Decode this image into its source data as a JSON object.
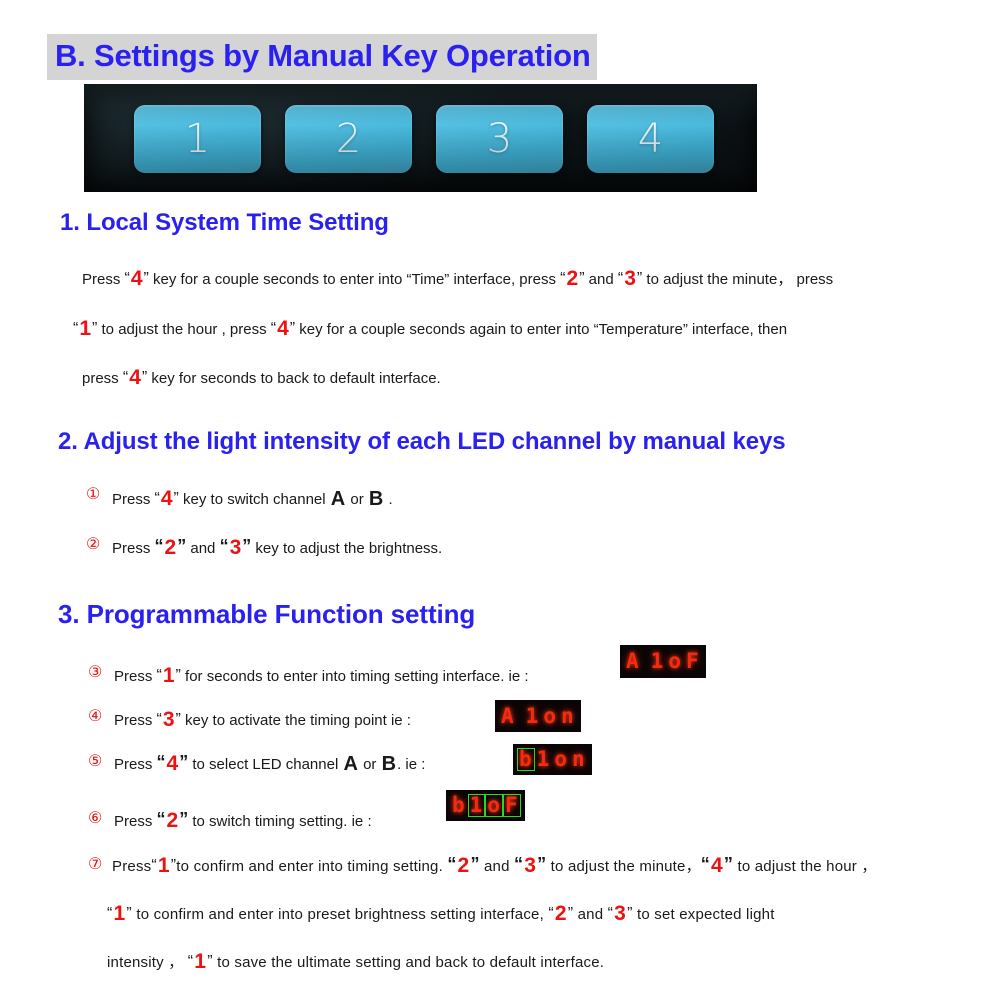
{
  "document": {
    "section_title": "B. Settings by Manual Key Operation",
    "title_highlight_color": "#d4d4d4",
    "heading_color": "#2a21f0",
    "key_accent_color": "#ee1111"
  },
  "keypad_photo": {
    "alt": "photo of four blue membrane keys",
    "keys": [
      "1",
      "2",
      "3",
      "4"
    ],
    "key_color": "#4ebcdf",
    "background_color": "#0c1215"
  },
  "sections": [
    {
      "id": "sec1",
      "heading": "1. Local System Time Setting",
      "lines": [
        {
          "id": "s1l1",
          "parts": [
            {
              "t": "text",
              "v": "Press "
            },
            {
              "t": "quote",
              "v": "“"
            },
            {
              "t": "key",
              "v": "4"
            },
            {
              "t": "quote",
              "v": "”"
            },
            {
              "t": "text",
              "v": " key for a couple seconds to enter into “Time” interface, press "
            },
            {
              "t": "quote",
              "v": "“"
            },
            {
              "t": "key",
              "v": "2"
            },
            {
              "t": "quote",
              "v": "”"
            },
            {
              "t": "text",
              "v": " and "
            },
            {
              "t": "quote",
              "v": "“"
            },
            {
              "t": "key",
              "v": "3"
            },
            {
              "t": "quote",
              "v": "”"
            },
            {
              "t": "text",
              "v": " to adjust the minute， press"
            }
          ]
        },
        {
          "id": "s1l2",
          "parts": [
            {
              "t": "quote",
              "v": "“"
            },
            {
              "t": "key",
              "v": "1"
            },
            {
              "t": "quote",
              "v": "”"
            },
            {
              "t": "text",
              "v": " to adjust the hour , press "
            },
            {
              "t": "quote",
              "v": "“"
            },
            {
              "t": "key",
              "v": "4"
            },
            {
              "t": "quote",
              "v": "”"
            },
            {
              "t": "text",
              "v": " key for a couple seconds again to enter into “Temperature” interface, then"
            }
          ]
        },
        {
          "id": "s1l3",
          "parts": [
            {
              "t": "text",
              "v": "press "
            },
            {
              "t": "quote",
              "v": "“"
            },
            {
              "t": "key",
              "v": "4"
            },
            {
              "t": "quote",
              "v": "”"
            },
            {
              "t": "text",
              "v": " key for seconds to back to default interface."
            }
          ]
        }
      ]
    },
    {
      "id": "sec2",
      "heading": "2. Adjust the light intensity of each LED channel by manual keys",
      "items": [
        {
          "marker": "①",
          "parts": [
            {
              "t": "text",
              "v": "Press "
            },
            {
              "t": "quote",
              "v": "“"
            },
            {
              "t": "key",
              "v": "4"
            },
            {
              "t": "quote",
              "v": "”"
            },
            {
              "t": "text",
              "v": " key to switch channel "
            },
            {
              "t": "chan",
              "v": "A"
            },
            {
              "t": "text",
              "v": " or "
            },
            {
              "t": "chan",
              "v": "B"
            },
            {
              "t": "text",
              "v": " ."
            }
          ]
        },
        {
          "marker": "②",
          "parts": [
            {
              "t": "text",
              "v": "Press "
            },
            {
              "t": "quoteb",
              "v": "“"
            },
            {
              "t": "key",
              "v": "2"
            },
            {
              "t": "quoteb",
              "v": "”"
            },
            {
              "t": "text",
              "v": " and "
            },
            {
              "t": "quoteb",
              "v": "“"
            },
            {
              "t": "key",
              "v": "3"
            },
            {
              "t": "quoteb",
              "v": "”"
            },
            {
              "t": "text",
              "v": " key to adjust the brightness."
            }
          ]
        }
      ]
    },
    {
      "id": "sec3",
      "heading": "3. Programmable Function setting",
      "items": [
        {
          "marker": "③",
          "parts": [
            {
              "t": "text",
              "v": "Press "
            },
            {
              "t": "quote",
              "v": "“"
            },
            {
              "t": "key",
              "v": "1"
            },
            {
              "t": "quote",
              "v": "”"
            },
            {
              "t": "text",
              "v": " for seconds to enter into timing setting interface.    ie :"
            }
          ],
          "led": {
            "cells": [
              "A",
              " ",
              "1",
              "o",
              "F"
            ],
            "highlight": []
          }
        },
        {
          "marker": "④",
          "parts": [
            {
              "t": "text",
              "v": "Press "
            },
            {
              "t": "quote",
              "v": "“"
            },
            {
              "t": "key",
              "v": "3"
            },
            {
              "t": "quote",
              "v": "”"
            },
            {
              "t": "text",
              "v": " key to activate the timing point     ie :"
            }
          ],
          "led": {
            "cells": [
              "A",
              " ",
              "1",
              "o",
              "n"
            ],
            "highlight": []
          }
        },
        {
          "marker": "⑤",
          "parts": [
            {
              "t": "text",
              "v": "Press "
            },
            {
              "t": "quoteb",
              "v": "“"
            },
            {
              "t": "key",
              "v": "4"
            },
            {
              "t": "quoteb",
              "v": "”"
            },
            {
              "t": "text",
              "v": " to select LED channel "
            },
            {
              "t": "chan",
              "v": "A"
            },
            {
              "t": "text",
              "v": " or "
            },
            {
              "t": "chan",
              "v": "B"
            },
            {
              "t": "text",
              "v": ".    ie :"
            }
          ],
          "led": {
            "cells": [
              "b",
              "1",
              "o",
              "n"
            ],
            "highlight": [
              0
            ]
          }
        },
        {
          "marker": "⑥",
          "parts": [
            {
              "t": "text",
              "v": "Press "
            },
            {
              "t": "quoteb",
              "v": "“"
            },
            {
              "t": "key",
              "v": "2"
            },
            {
              "t": "quoteb",
              "v": "”"
            },
            {
              "t": "text",
              "v": " to switch timing setting.   ie :"
            }
          ],
          "led": {
            "cells": [
              "b",
              "1",
              "o",
              "F"
            ],
            "highlight": [
              1,
              2,
              3
            ]
          }
        }
      ],
      "item7": {
        "marker": "⑦",
        "lines": [
          {
            "id": "s3l1",
            "parts": [
              {
                "t": "text",
                "v": "Press"
              },
              {
                "t": "quote",
                "v": "“"
              },
              {
                "t": "key",
                "v": "1"
              },
              {
                "t": "quote",
                "v": "”"
              },
              {
                "t": "text",
                "v": "to confirm and enter into timing setting. "
              },
              {
                "t": "quoteb",
                "v": "“"
              },
              {
                "t": "key",
                "v": "2"
              },
              {
                "t": "quoteb",
                "v": "”"
              },
              {
                "t": "text",
                "v": " and "
              },
              {
                "t": "quoteb",
                "v": "“"
              },
              {
                "t": "key",
                "v": "3"
              },
              {
                "t": "quoteb",
                "v": "”"
              },
              {
                "t": "text",
                "v": " to adjust the minute，"
              },
              {
                "t": "quoteb",
                "v": "“"
              },
              {
                "t": "key",
                "v": "4"
              },
              {
                "t": "quoteb",
                "v": "”"
              },
              {
                "t": "text",
                "v": " to adjust the hour ，"
              }
            ]
          },
          {
            "id": "s3l2",
            "parts": [
              {
                "t": "quote",
                "v": "“"
              },
              {
                "t": "key",
                "v": "1"
              },
              {
                "t": "quote",
                "v": "”"
              },
              {
                "t": "text",
                "v": "  to  confirm  and  enter  into  preset  brightness  setting  interface,  "
              },
              {
                "t": "quote",
                "v": "“"
              },
              {
                "t": "key",
                "v": "2"
              },
              {
                "t": "quote",
                "v": "”"
              },
              {
                "t": "text",
                "v": "  and  "
              },
              {
                "t": "quote",
                "v": "“"
              },
              {
                "t": "key",
                "v": "3"
              },
              {
                "t": "quote",
                "v": "”"
              },
              {
                "t": "text",
                "v": "  to  set  expected  light"
              }
            ]
          },
          {
            "id": "s3l3",
            "parts": [
              {
                "t": "text",
                "v": "intensity ， "
              },
              {
                "t": "quote",
                "v": "“"
              },
              {
                "t": "key",
                "v": "1"
              },
              {
                "t": "quote",
                "v": "”"
              },
              {
                "t": "text",
                "v": " to save the ultimate setting and back to default interface."
              }
            ]
          }
        ]
      }
    }
  ]
}
